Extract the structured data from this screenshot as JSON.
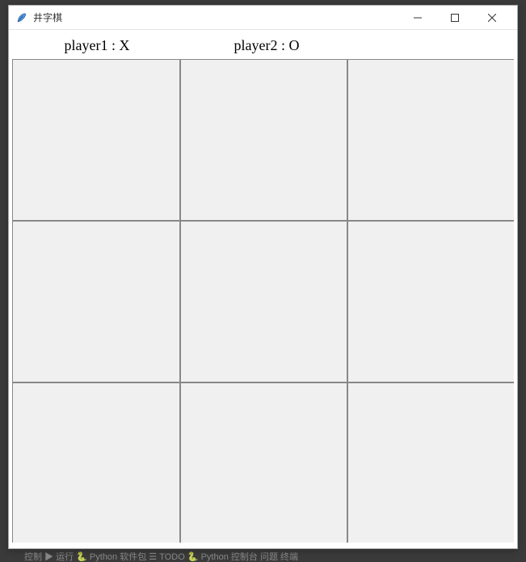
{
  "window": {
    "title": "井字棋"
  },
  "titlebar_controls": {
    "minimize": "minimize",
    "maximize": "maximize",
    "close": "close"
  },
  "players": {
    "player1_label": "player1 : X",
    "player2_label": "player2 : O"
  },
  "board": {
    "cells": [
      "",
      "",
      "",
      "",
      "",
      "",
      "",
      "",
      ""
    ]
  },
  "background_strip": "控制    ▶ 运行    🐍 Python 软件包    ☰ TODO    🐍 Python 控制台    问题    终端"
}
